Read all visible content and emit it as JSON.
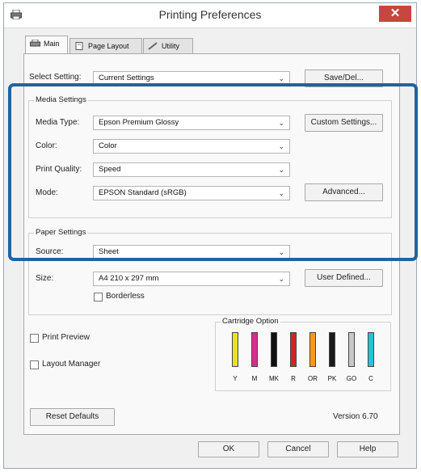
{
  "window": {
    "title": "Printing Preferences",
    "close_glyph": "✕"
  },
  "tabs": [
    {
      "label": "Main",
      "icon": "printer-icon"
    },
    {
      "label": "Page Layout",
      "icon": "page-icon"
    },
    {
      "label": "Utility",
      "icon": "utility-icon"
    }
  ],
  "select_setting": {
    "label": "Select Setting:",
    "value": "Current Settings",
    "button": "Save/Del..."
  },
  "media_settings": {
    "title": "Media Settings",
    "media_type": {
      "label": "Media Type:",
      "value": "Epson Premium Glossy",
      "button": "Custom Settings..."
    },
    "color": {
      "label": "Color:",
      "value": "Color"
    },
    "print_quality": {
      "label": "Print Quality:",
      "value": "Speed"
    },
    "mode": {
      "label": "Mode:",
      "value": "EPSON Standard (sRGB)",
      "button": "Advanced..."
    }
  },
  "paper_settings": {
    "title": "Paper Settings",
    "source": {
      "label": "Source:",
      "value": "Sheet"
    },
    "size": {
      "label": "Size:",
      "value": "A4 210 x 297 mm",
      "button": "User Defined..."
    },
    "borderless": "Borderless"
  },
  "print_preview": "Print Preview",
  "layout_manager": "Layout Manager",
  "cartridge": {
    "title": "Cartridge Option",
    "inks": [
      {
        "code": "Y",
        "color": "#e8e41c"
      },
      {
        "code": "M",
        "color": "#d72d8c"
      },
      {
        "code": "MK",
        "color": "#111111"
      },
      {
        "code": "R",
        "color": "#d2232a"
      },
      {
        "code": "OR",
        "color": "#f39a1d"
      },
      {
        "code": "PK",
        "color": "#1a1a1a"
      },
      {
        "code": "GO",
        "color": "#c8c8c8"
      },
      {
        "code": "C",
        "color": "#27c3d8"
      }
    ]
  },
  "reset_defaults": "Reset Defaults",
  "version": "Version 6.70",
  "footer": {
    "ok": "OK",
    "cancel": "Cancel",
    "help": "Help"
  },
  "colors": {
    "highlight": "#1f63a3",
    "close": "#c7463d"
  }
}
